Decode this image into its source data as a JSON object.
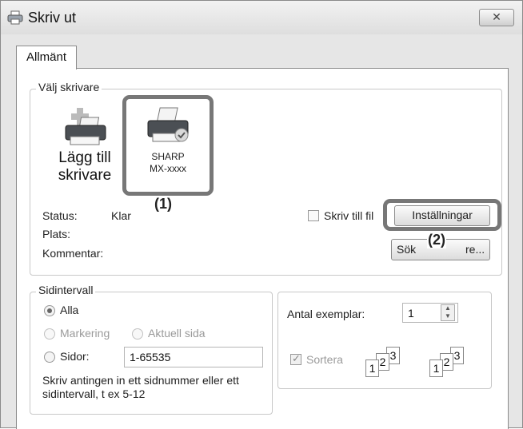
{
  "window": {
    "title": "Skriv ut",
    "close_label": "✕"
  },
  "tabs": [
    {
      "label": "Allmänt",
      "active": true
    }
  ],
  "select_printer": {
    "group_label": "Välj skrivare",
    "printers": [
      {
        "label_line1": "Lägg till",
        "label_line2": "skrivare",
        "icon": "add-printer-icon"
      },
      {
        "label_line1": "SHARP",
        "label_line2": "MX-xxxx",
        "icon": "printer-icon",
        "selected": true
      }
    ],
    "status_label": "Status:",
    "status_value": "Klar",
    "location_label": "Plats:",
    "comment_label": "Kommentar:",
    "print_to_file_label": "Skriv till fil",
    "print_to_file_checked": false,
    "preferences_button": "Inställningar",
    "find_printer_button_start": "Sök",
    "find_printer_button_end": "re...",
    "callout_1": "(1)",
    "callout_2": "(2)"
  },
  "page_range": {
    "group_label": "Sidintervall",
    "option_all": "Alla",
    "option_selection": "Markering",
    "option_current": "Aktuell sida",
    "option_pages": "Sidor:",
    "pages_value": "1-65535",
    "hint_line1": "Skriv antingen in ett sidnummer eller ett",
    "hint_line2": "sidintervall, t ex 5-12",
    "selected": "all"
  },
  "copies": {
    "label": "Antal exemplar:",
    "value": "1",
    "collate_label": "Sortera",
    "collate_checked": true,
    "collate_pages": [
      "1",
      "2",
      "3"
    ]
  },
  "colors": {
    "highlight": "#777777",
    "window_bg": "#e6e6e6"
  }
}
